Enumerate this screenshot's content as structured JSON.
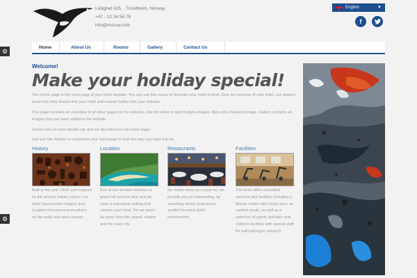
{
  "header": {
    "address_lines": [
      "Leilighet 425, , Trondheim, Norway",
      "+47 - 12 34 56 78",
      "info@moruw.com"
    ],
    "language": "English",
    "social": {
      "facebook_label": "f",
      "twitter_label": "t"
    }
  },
  "nav": {
    "items": [
      {
        "label": "Home"
      },
      {
        "label": "About Us"
      },
      {
        "label": "Rooms"
      },
      {
        "label": "Gallery"
      },
      {
        "label": "Contact Us"
      }
    ]
  },
  "main": {
    "welcome": "Welcome!",
    "headline": "Make your holiday special!",
    "paragraphs": [
      "The Home page is the main page of your hotel website. You can use this space to describe your hotel in brief. Give an overview of your hotel. Let viewers know why they should visit your hotel and browse further into your website.",
      "This page contains an overview of all other pages on the website. Use the slider to add multiple images. Also add a featured image. Gallery contains all images that you have added to the website.",
      "A brief view of room details can also be described on the home page.",
      "Use our Site Builder to customise your homepage to look the way you want it to be."
    ]
  },
  "cards": [
    {
      "title": "History",
      "text": "Built in the year 19XX and inspired by the ancient Indian culture, our hotel has pictorial imagery and sculpted characters everywhere on the walls and open spaces."
    },
    {
      "title": "Location",
      "text": "Due to our location between a green hill and the blue sea we have a marvelous setting that relaxes your mind. Yet we aren't far away from the airport, station and the main city."
    },
    {
      "title": "Restaurants",
      "text": "No matter what you crave for, we provide you an outstanding, lip smacking dining experience, amidst the most idyllic environment."
    },
    {
      "title": "Facilities",
      "text": "The hotel offers unrivalled services and facilities including a fitness centre with indoor pool, an outdoor pools, as well as a selection of sports activities and children facilities with special staff for babysitting(on request)."
    }
  ],
  "colors": {
    "brand": "#1d4f91",
    "link": "#4a79a8",
    "text_muted": "#999999"
  },
  "icons": {
    "side_tool": "gear-icon"
  }
}
